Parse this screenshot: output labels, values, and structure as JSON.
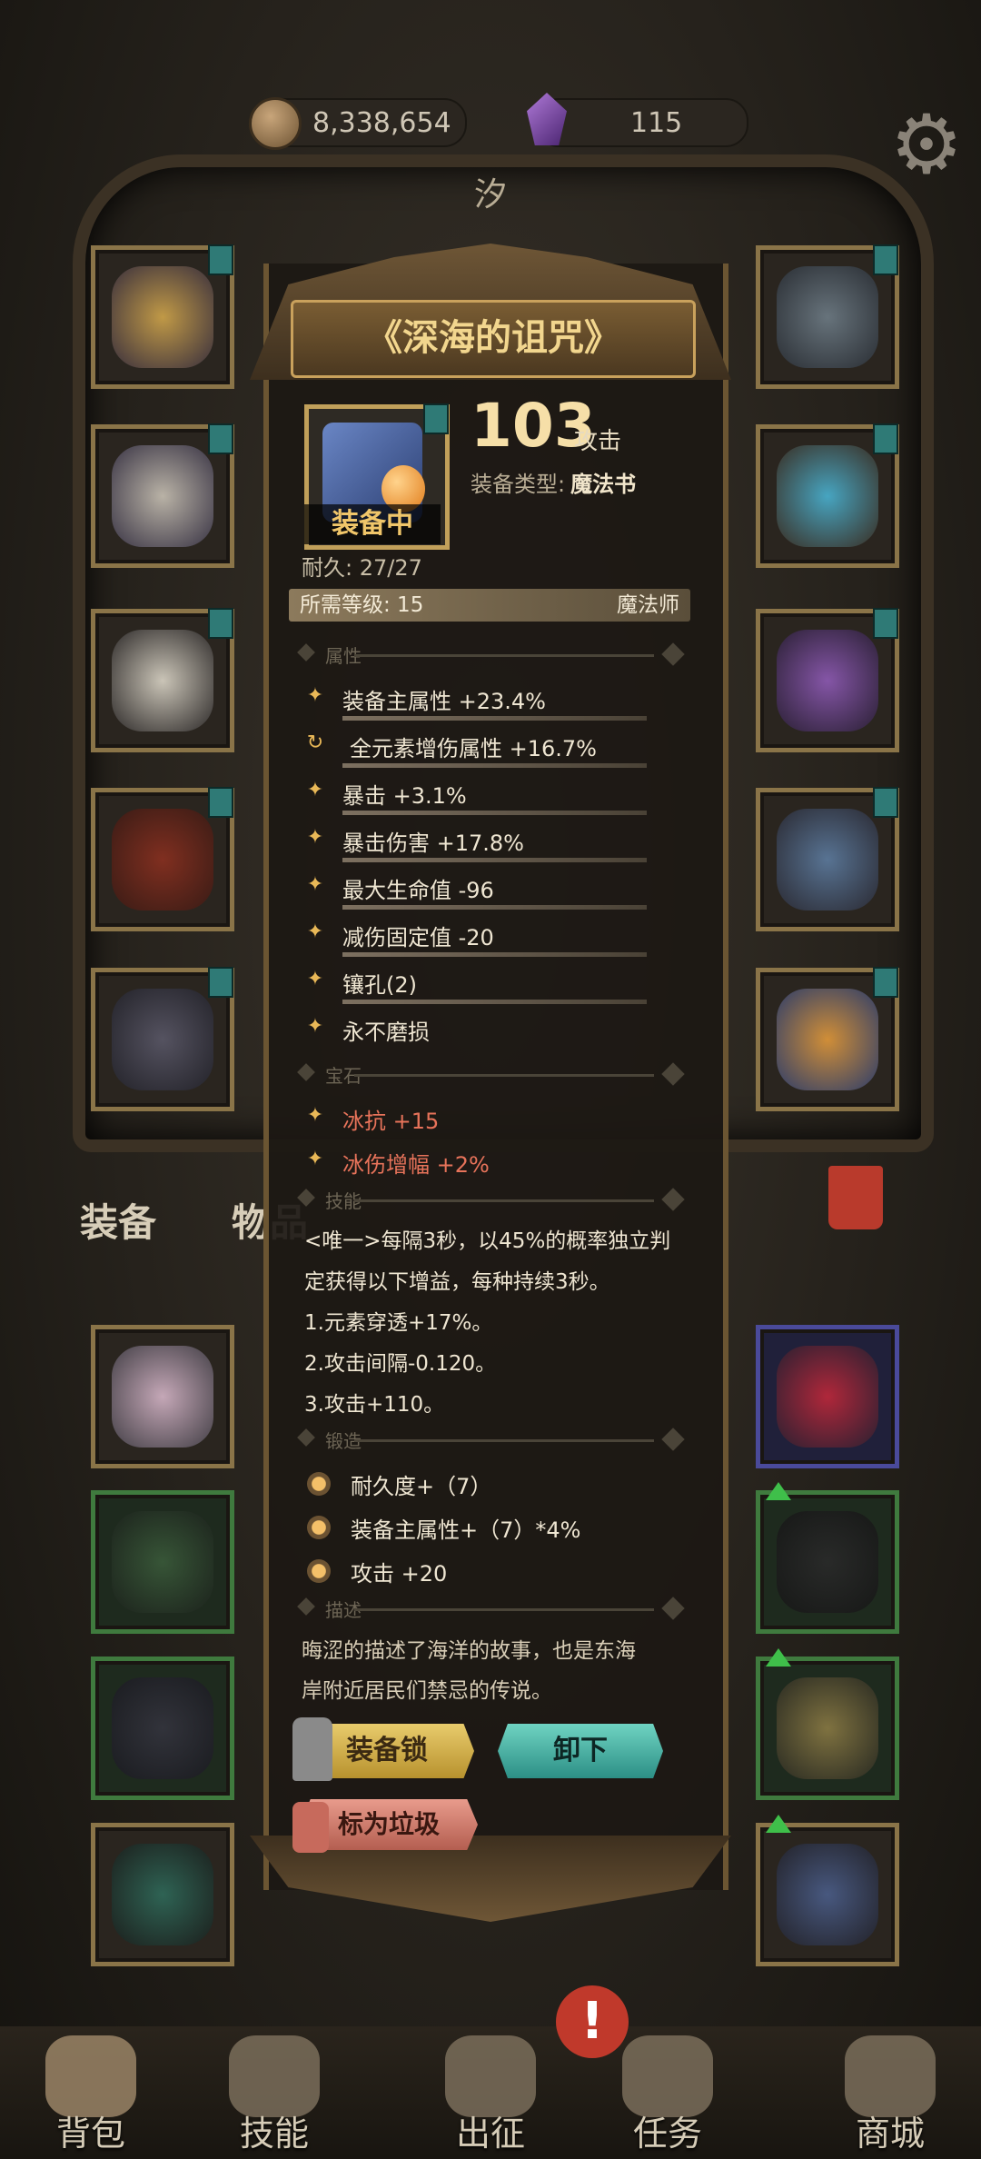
{
  "currency": {
    "gold": "8,338,654",
    "gems": "115"
  },
  "top_tab": "汐",
  "inventory_tabs": {
    "equipment": "装备",
    "items": "物品"
  },
  "item": {
    "name": "《深海的诅咒》",
    "status": "装备中",
    "power": "103",
    "power_unit": "攻击",
    "type_label": "装备类型:",
    "type_value": "魔法书",
    "durability": "耐久: 27/27",
    "required_level": "所需等级: 15",
    "class": "魔法师",
    "sections": {
      "attributes": "属性",
      "gems": "宝石",
      "skills": "技能",
      "forge": "锻造",
      "description": "描述"
    },
    "attributes": [
      {
        "icon": "star-icon",
        "text": "装备主属性 +23.4%"
      },
      {
        "icon": "cycle-icon",
        "text": "全元素增伤属性 +16.7%"
      },
      {
        "icon": "star-icon",
        "text": "暴击 +3.1%"
      },
      {
        "icon": "star-icon",
        "text": "暴击伤害 +17.8%"
      },
      {
        "icon": "star-icon",
        "text": "最大生命值 -96"
      },
      {
        "icon": "star-icon",
        "text": "减伤固定值 -20"
      },
      {
        "icon": "star-icon",
        "text": "镶孔(2)"
      },
      {
        "icon": "star-icon",
        "text": "永不磨损"
      }
    ],
    "gem_attributes": [
      {
        "icon": "star-icon",
        "text": "冰抗 +15"
      },
      {
        "icon": "star-icon",
        "text": "冰伤增幅 +2%"
      }
    ],
    "skill_lines": [
      "<唯一>每隔3秒，以45%的概率独立判",
      "定获得以下增益，每种持续3秒。",
      "1.元素穿透+17%。",
      "2.攻击间隔-0.120。",
      "3.攻击+110。"
    ],
    "forge_lines": [
      "耐久度+（7）",
      "装备主属性+（7）*4%",
      "攻击 +20"
    ],
    "description_lines": [
      "晦涩的描述了海洋的故事，也是东海",
      "岸附近居民们禁忌的传说。"
    ],
    "buttons": {
      "lock": "装备锁",
      "unequip": "卸下",
      "mark_trash": "标为垃圾"
    }
  },
  "nav": [
    {
      "label": "背包",
      "icon": "backpack-icon"
    },
    {
      "label": "技能",
      "icon": "skill-book-icon"
    },
    {
      "label": "出征",
      "icon": "battle-icon"
    },
    {
      "label": "任务",
      "icon": "quest-scroll-icon"
    },
    {
      "label": "商城",
      "icon": "shop-icon"
    }
  ],
  "alert_badge": "!",
  "colors": {
    "accent_gold": "#e9b857",
    "gem_red": "#e7735a",
    "unequip_teal": "#2c8f86"
  }
}
